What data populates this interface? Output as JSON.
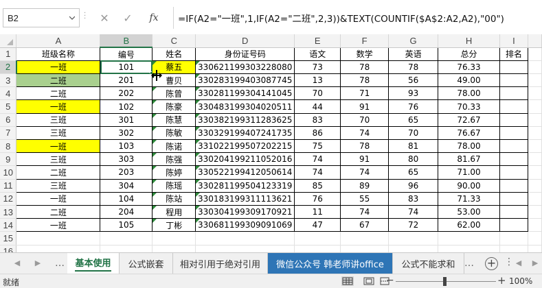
{
  "formula_bar": {
    "name_box": "B2",
    "formula": "=IF(A2=\"一班\",1,IF(A2=\"二班\",2,3))&TEXT(COUNTIF($A$2:A2,A2),\"00\")",
    "cancel_glyph": "✕",
    "enter_glyph": "✓",
    "fx_label": "fx"
  },
  "columns": [
    "A",
    "B",
    "C",
    "D",
    "E",
    "F",
    "G",
    "H",
    "I"
  ],
  "selected_column": "B",
  "selected_row": 2,
  "headers": [
    "班级名称",
    "编号",
    "姓名",
    "身份证号码",
    "语文",
    "数学",
    "英语",
    "总分",
    "排名"
  ],
  "rows": [
    {
      "row": 2,
      "cells": [
        "一班",
        "101",
        "蔡五",
        "330621199303228080",
        "73",
        "78",
        "78",
        "76.33",
        ""
      ],
      "fill": "yellow"
    },
    {
      "row": 3,
      "cells": [
        "二班",
        "201",
        "曹贝",
        "330283199403087745",
        "13",
        "78",
        "56",
        "49.00",
        ""
      ],
      "fill": "green"
    },
    {
      "row": 4,
      "cells": [
        "二班",
        "202",
        "陈曾",
        "330281199304141045",
        "70",
        "71",
        "93",
        "78.00",
        ""
      ],
      "fill": ""
    },
    {
      "row": 5,
      "cells": [
        "一班",
        "102",
        "陈豪",
        "330483199304020511",
        "44",
        "91",
        "76",
        "70.33",
        ""
      ],
      "fill": "yellow"
    },
    {
      "row": 6,
      "cells": [
        "三班",
        "301",
        "陈慧",
        "330382199311283625",
        "83",
        "70",
        "65",
        "72.67",
        ""
      ],
      "fill": ""
    },
    {
      "row": 7,
      "cells": [
        "三班",
        "302",
        "陈敏",
        "330329199407241735",
        "86",
        "74",
        "70",
        "76.67",
        ""
      ],
      "fill": ""
    },
    {
      "row": 8,
      "cells": [
        "一班",
        "103",
        "陈诺",
        "331022199507202215",
        "75",
        "78",
        "81",
        "78.00",
        ""
      ],
      "fill": "yellow"
    },
    {
      "row": 9,
      "cells": [
        "三班",
        "303",
        "陈强",
        "330204199211052016",
        "74",
        "91",
        "80",
        "81.67",
        ""
      ],
      "fill": ""
    },
    {
      "row": 10,
      "cells": [
        "二班",
        "203",
        "陈婷",
        "330522199412050614",
        "74",
        "74",
        "65",
        "71.00",
        ""
      ],
      "fill": ""
    },
    {
      "row": 11,
      "cells": [
        "三班",
        "304",
        "陈瑶",
        "330281199504123319",
        "85",
        "89",
        "96",
        "90.00",
        ""
      ],
      "fill": ""
    },
    {
      "row": 12,
      "cells": [
        "一班",
        "104",
        "陈站",
        "330183199311113621",
        "76",
        "55",
        "83",
        "71.33",
        ""
      ],
      "fill": ""
    },
    {
      "row": 13,
      "cells": [
        "二班",
        "204",
        "程用",
        "330304199309170921",
        "11",
        "74",
        "74",
        "53.00",
        ""
      ],
      "fill": ""
    },
    {
      "row": 14,
      "cells": [
        "一班",
        "105",
        "丁彬",
        "330681199309091069",
        "47",
        "67",
        "72",
        "62.00",
        ""
      ],
      "fill": ""
    }
  ],
  "empty_rows": [
    15,
    16
  ],
  "colors": {
    "yellow": "#ffff00",
    "green": "#a9d08e",
    "accent": "#217346",
    "blue_tab": "#2e75b6"
  },
  "sheet_tabs": [
    {
      "label": "基本使用",
      "active": true
    },
    {
      "label": "公式嵌套",
      "active": false
    },
    {
      "label": "相对引用于绝对引用",
      "active": false
    },
    {
      "label": "微信公众号 韩老师讲office",
      "active": false,
      "highlight": true
    },
    {
      "label": "公式不能求和",
      "active": false
    }
  ],
  "status": {
    "mode": "就绪",
    "zoom": "100%"
  },
  "icons": {
    "name_box_dropdown": "chevron-down-icon",
    "cancel": "close-icon",
    "enter": "check-icon",
    "function": "fx-icon",
    "tab_prev": "triangle-left-icon",
    "tab_next": "triangle-right-icon",
    "add_sheet": "plus-circle-icon",
    "more": "ellipsis-icon",
    "view_normal": "grid-view-icon",
    "view_layout": "page-layout-icon",
    "view_break": "page-break-icon",
    "zoom_out": "minus-icon",
    "zoom_in": "plus-icon",
    "cursor": "column-resize-cursor-icon"
  }
}
